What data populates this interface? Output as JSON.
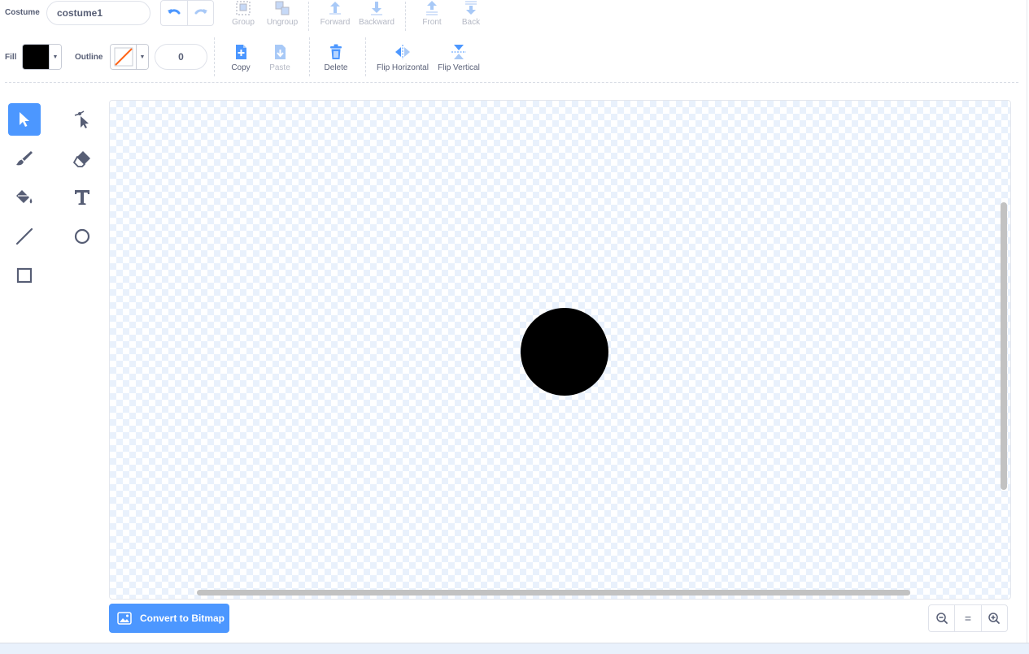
{
  "costume": {
    "label": "Costume",
    "name": "costume1"
  },
  "arrange": {
    "group": "Group",
    "ungroup": "Ungroup",
    "forward": "Forward",
    "backward": "Backward",
    "front": "Front",
    "back": "Back"
  },
  "style": {
    "fill_label": "Fill",
    "outline_label": "Outline",
    "outline_width": "0",
    "fill_color": "#000000"
  },
  "edit": {
    "copy": "Copy",
    "paste": "Paste",
    "delete": "Delete",
    "flip_horizontal": "Flip Horizontal",
    "flip_vertical": "Flip Vertical"
  },
  "tools": [
    "select",
    "reshape",
    "brush",
    "eraser",
    "fill",
    "text",
    "line",
    "circle",
    "rectangle"
  ],
  "canvas": {
    "shape": "circle",
    "color": "#000000"
  },
  "footer": {
    "convert_label": "Convert to Bitmap",
    "zoom_reset": "="
  },
  "colors": {
    "accent": "#4c97ff",
    "text": "#575e75",
    "disabled": "#b4b8c4"
  }
}
